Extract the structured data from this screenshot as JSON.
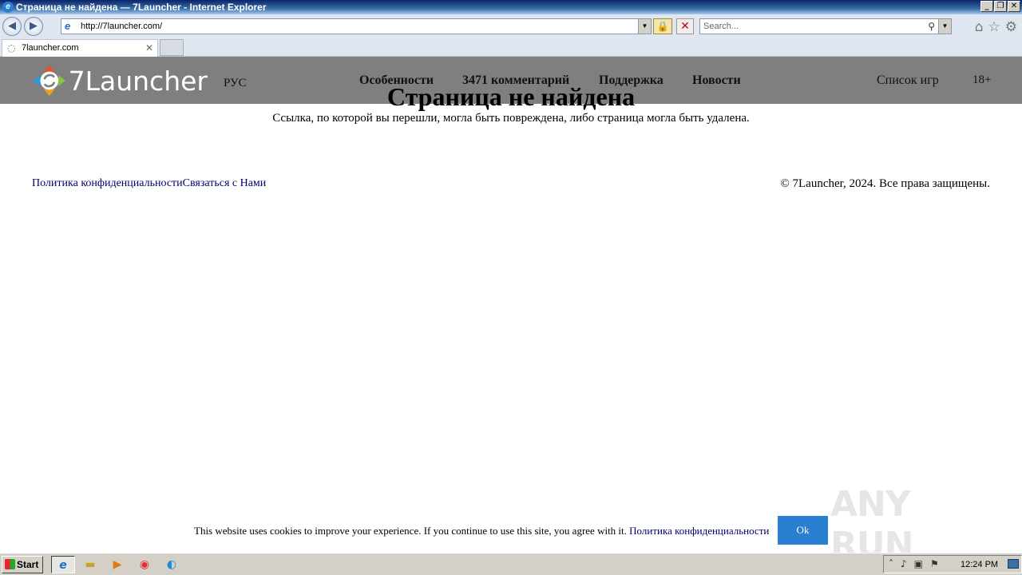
{
  "window": {
    "title": "Страница не найдена — 7Launcher - Internet Explorer",
    "controls": [
      "_",
      "❐",
      "✕"
    ]
  },
  "browser": {
    "address_value": "http://7launcher.com/",
    "search_placeholder": "Search...",
    "tab_label": "7launcher.com",
    "icons": [
      "back-icon",
      "forward-icon",
      "lock-icon",
      "stop-icon",
      "home-icon",
      "favorites-icon",
      "settings-icon"
    ]
  },
  "site": {
    "logo_text": "7Launcher",
    "lang": "РУС",
    "menu": [
      "Особенности",
      "3471 комментарий",
      "Поддержка",
      "Новости"
    ],
    "games": "Список игр",
    "age": "18+",
    "header_bg": "#7f7f7f"
  },
  "notfound": {
    "title": "Страница не найдена",
    "text": "Ссылка, по которой вы перешли, могла быть повреждена, либо страница могла быть удалена."
  },
  "footer": {
    "privacy": "Политика конфиденциальности",
    "contact": "Связаться с Нами",
    "copyright": "© 7Launcher, 2024. Все права защищены."
  },
  "cookie": {
    "text": "This website uses cookies to improve your experience. If you continue to use this site, you agree with it.",
    "link": "Политика конфиденциальности",
    "ok": "Ok",
    "accent": "#2b7fd1"
  },
  "watermark": "ANY RUN",
  "taskbar": {
    "start": "Start",
    "apps": [
      "internet-explorer-icon",
      "file-explorer-icon",
      "media-player-icon",
      "chrome-icon",
      "edge-icon"
    ],
    "clock": "12:24 PM"
  }
}
